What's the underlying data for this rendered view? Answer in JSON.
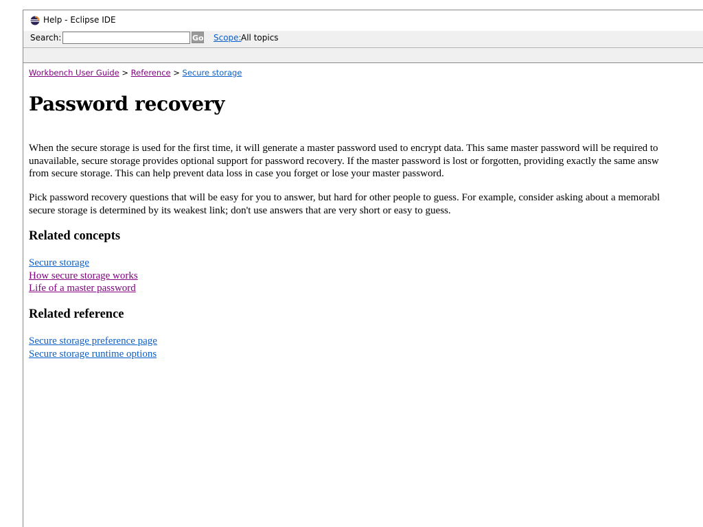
{
  "window": {
    "title": "Help - Eclipse IDE",
    "icon": "eclipse-logo-icon"
  },
  "search": {
    "label": "Search:",
    "value": "",
    "placeholder": "",
    "go_label": "Go",
    "scope_label": "Scope:",
    "scope_value": "All topics"
  },
  "breadcrumb": {
    "items": [
      "Workbench User Guide",
      "Reference",
      "Secure storage"
    ],
    "separator": ">"
  },
  "article": {
    "title": "Password recovery",
    "paragraph1_lines": [
      "When the secure storage is used for the first time, it will generate a master password used to encrypt data. This same master password will be required to",
      "unavailable, secure storage provides optional support for password recovery. If the master password is lost or forgotten, providing exactly the same answ",
      "from secure storage. This can help prevent data loss in case you forget or lose your master password."
    ],
    "paragraph2_lines": [
      "Pick password recovery questions that will be easy for you to answer, but hard for other people to guess. For example, consider asking about a memorabl",
      "secure storage is determined by its weakest link; don't use answers that are very short or easy to guess."
    ],
    "related_concepts": {
      "heading": "Related concepts",
      "links": [
        "Secure storage",
        "How secure storage works",
        "Life of a master password"
      ]
    },
    "related_reference": {
      "heading": "Related reference",
      "links": [
        "Secure storage preference page",
        "Secure storage runtime options"
      ]
    }
  },
  "colors": {
    "link": "#0a5fc8",
    "visited_link": "#800080",
    "toolbar_bg": "#f0f0f0"
  }
}
